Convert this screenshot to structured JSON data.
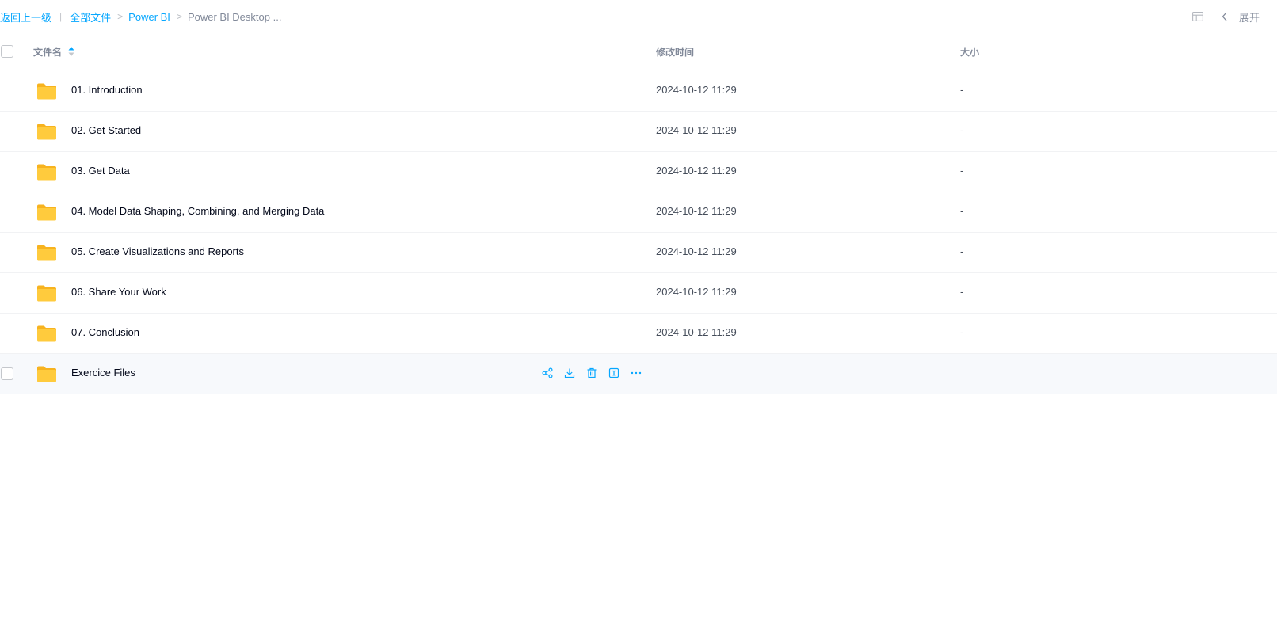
{
  "breadcrumb": {
    "back": "返回上一级",
    "separator_bar": "|",
    "all_files": "全部文件",
    "sep": ">",
    "level1": "Power BI",
    "current": "Power BI Desktop ..."
  },
  "top_right": {
    "expand_label": "展开",
    "grid_icon": "grid-view-icon",
    "chevron_icon": "chevron-left-icon"
  },
  "table": {
    "headers": {
      "name": "文件名",
      "modified": "修改时间",
      "size": "大小"
    },
    "rows": [
      {
        "name": "01. Introduction",
        "modified": "2024-10-12 11:29",
        "size": "-"
      },
      {
        "name": "02. Get Started",
        "modified": "2024-10-12 11:29",
        "size": "-"
      },
      {
        "name": "03. Get Data",
        "modified": "2024-10-12 11:29",
        "size": "-"
      },
      {
        "name": "04. Model Data Shaping, Combining, and Merging Data",
        "modified": "2024-10-12 11:29",
        "size": "-"
      },
      {
        "name": "05. Create Visualizations and Reports",
        "modified": "2024-10-12 11:29",
        "size": "-"
      },
      {
        "name": "06. Share Your Work",
        "modified": "2024-10-12 11:29",
        "size": "-"
      },
      {
        "name": "07. Conclusion",
        "modified": "2024-10-12 11:29",
        "size": "-"
      },
      {
        "name": "Exercice Files",
        "modified": "",
        "size": ""
      }
    ],
    "hover_actions": [
      "share-icon",
      "download-icon",
      "delete-icon",
      "rename-icon",
      "more-icon"
    ]
  },
  "colors": {
    "accent": "#06a7ff",
    "folder": "#ffc933",
    "muted": "#818999",
    "hover_row": "#f7f9fc"
  }
}
